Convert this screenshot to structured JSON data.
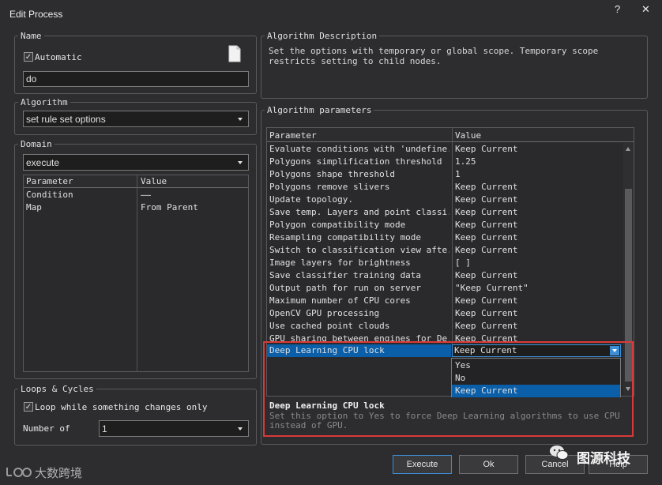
{
  "window": {
    "title": "Edit Process",
    "help": "?",
    "close": "✕"
  },
  "name_group": {
    "legend": "Name",
    "automatic_label": "Automatic",
    "automatic_checked": true,
    "name_value": "do",
    "doc_icon": "document-icon"
  },
  "algorithm_group": {
    "legend": "Algorithm",
    "selected": "set rule set options"
  },
  "domain_group": {
    "legend": "Domain",
    "selected": "execute",
    "headers": [
      "Parameter",
      "Value"
    ],
    "rows": [
      [
        "Condition",
        "——"
      ],
      [
        "Map",
        "From Parent"
      ]
    ]
  },
  "loops_group": {
    "legend": "Loops & Cycles",
    "loop_label": "Loop while something changes only",
    "loop_checked": true,
    "number_label": "Number of",
    "number_value": "1"
  },
  "description_group": {
    "legend": "Algorithm Description",
    "text": "Set the options with temporary or global scope. Temporary scope restricts setting to child nodes."
  },
  "params_group": {
    "legend": "Algorithm parameters",
    "headers": [
      "Parameter",
      "Value"
    ],
    "rows": [
      [
        "Evaluate conditions with 'undefine...",
        "Keep Current"
      ],
      [
        "Polygons simplification threshold",
        "1.25"
      ],
      [
        "Polygons shape threshold",
        "1"
      ],
      [
        "Polygons remove slivers",
        "Keep Current"
      ],
      [
        "Update topology.",
        "Keep Current"
      ],
      [
        "Save temp. Layers and point classi...",
        "Keep Current"
      ],
      [
        "Polygon compatibility mode",
        "Keep Current"
      ],
      [
        "Resampling compatibility mode",
        "Keep Current"
      ],
      [
        "Switch to classification view afte...",
        "Keep Current"
      ],
      [
        "Image layers for brightness",
        "[  ]"
      ],
      [
        "Save classifier training data",
        "Keep Current"
      ],
      [
        "Output path for run on server",
        "\"Keep Current\""
      ],
      [
        "Maximum number of CPU cores",
        "Keep Current"
      ],
      [
        "OpenCV GPU processing",
        "Keep Current"
      ],
      [
        "Use cached point clouds",
        "Keep Current"
      ],
      [
        "GPU sharing between engines for De...",
        "Keep Current"
      ]
    ],
    "selected_row": {
      "param": "Deep Learning CPU lock",
      "value": "Keep Current"
    },
    "dropdown_options": [
      "Yes",
      "No",
      "Keep Current"
    ],
    "dropdown_selected": "Keep Current",
    "info_title": "Deep Learning CPU lock",
    "info_text": "Set this option to Yes to force Deep Learning algorithms to use CPU instead of GPU."
  },
  "buttons": {
    "execute": "Execute",
    "ok": "Ok",
    "cancel": "Cancel",
    "help": "Help"
  },
  "watermarks": {
    "left": "大数跨境",
    "right": "图源科技"
  },
  "colors": {
    "selection": "#0a5fa8",
    "highlight_border": "#d83a3a",
    "accent": "#3c8ed6"
  }
}
